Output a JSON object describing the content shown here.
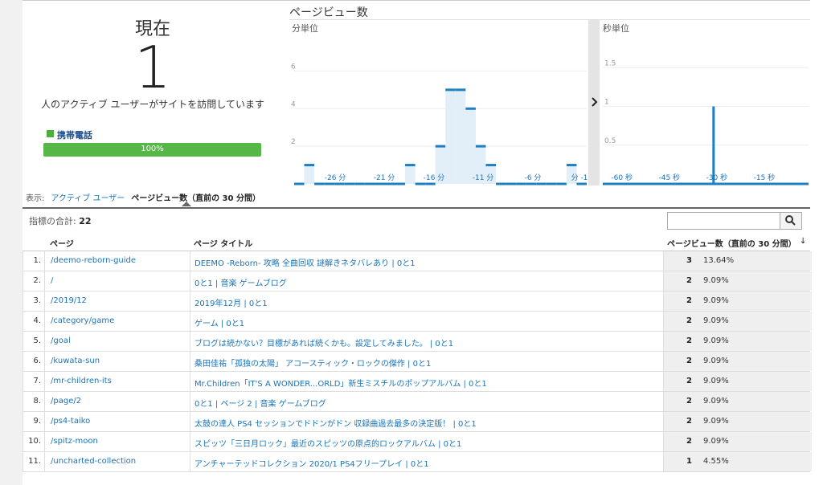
{
  "summary": {
    "now_title": "現在",
    "active_users": "1",
    "description": "人のアクティブ ユーザーがサイトを訪問しています",
    "device_label": "携帯電話",
    "device_percent_text": "100%",
    "device_fraction": 1.0,
    "device_color": "#55b745"
  },
  "chart": {
    "title": "ページビュー数",
    "minute_label": "分単位",
    "second_label": "秒単位",
    "expand_icon": "chevron-right-icon"
  },
  "chart_data": [
    {
      "type": "bar",
      "title": "分単位",
      "ylim": [
        0,
        7
      ],
      "yticks": [
        2,
        4,
        6
      ],
      "xticks": [
        "-26 分",
        "-21 分",
        "-16 分",
        "-11 分",
        "-6 分",
        "分 -1"
      ],
      "categories": [
        "-29",
        "-28",
        "-27",
        "-26",
        "-25",
        "-24",
        "-23",
        "-22",
        "-21",
        "-20",
        "-19",
        "-18",
        "-17",
        "-16",
        "-15",
        "-14",
        "-13",
        "-12",
        "-11",
        "-10",
        "-9",
        "-8",
        "-7",
        "-6",
        "-5",
        "-4",
        "-3",
        "-2",
        "-1"
      ],
      "values": [
        0,
        1,
        0,
        0,
        0,
        0,
        0,
        0,
        0,
        0,
        0,
        1,
        0,
        0,
        2,
        5,
        5,
        4,
        2,
        1,
        0,
        0,
        0,
        0,
        0,
        0,
        0,
        1,
        0
      ]
    },
    {
      "type": "bar",
      "title": "秒単位",
      "ylim": [
        0,
        1.7
      ],
      "yticks": [
        0.5,
        1,
        1.5
      ],
      "xticks": [
        "-60 秒",
        "-45 秒",
        "-30 秒",
        "-15 秒"
      ],
      "spike_at_seconds": -30,
      "spike_value": 1
    }
  ],
  "view_tabs": {
    "prefix": "表示:",
    "tab1": "アクティブ ユーザー",
    "tab2": "ページビュー数（直前の 30 分間）"
  },
  "table": {
    "totals_label": "指標の合計:",
    "totals_value": "22",
    "search_placeholder": "",
    "col_page": "ページ",
    "col_title": "ページ タイトル",
    "col_metric": "ページビュー数（直前の 30 分間）",
    "rows": [
      {
        "n": "1.",
        "path": "/deemo-reborn-guide",
        "title": "DEEMO -Reborn- 攻略 全曲回収 謎解きネタバレあり | 0と1",
        "value": "3",
        "pct": "13.64%"
      },
      {
        "n": "2.",
        "path": "/",
        "title": "0と1 | 音楽 ゲームブログ",
        "value": "2",
        "pct": "9.09%"
      },
      {
        "n": "3.",
        "path": "/2019/12",
        "title": "2019年12月 | 0と1",
        "value": "2",
        "pct": "9.09%"
      },
      {
        "n": "4.",
        "path": "/category/game",
        "title": "ゲーム | 0と1",
        "value": "2",
        "pct": "9.09%"
      },
      {
        "n": "5.",
        "path": "/goal",
        "title": "ブログは続かない？目標があれば続くかも。設定してみました。 | 0と1",
        "value": "2",
        "pct": "9.09%"
      },
      {
        "n": "6.",
        "path": "/kuwata-sun",
        "title": "桑田佳祐「孤独の太陽」 アコースティック・ロックの傑作 | 0と1",
        "value": "2",
        "pct": "9.09%"
      },
      {
        "n": "7.",
        "path": "/mr-children-its",
        "title": "Mr.Children「IT'S A WONDER...ORLD」新生ミスチルのポップアルバム | 0と1",
        "value": "2",
        "pct": "9.09%"
      },
      {
        "n": "8.",
        "path": "/page/2",
        "title": "0と1 | ページ 2 | 音楽 ゲームブログ",
        "value": "2",
        "pct": "9.09%"
      },
      {
        "n": "9.",
        "path": "/ps4-taiko",
        "title": "太鼓の達人 PS4 セッションでドドンがドン 収録曲過去最多の決定版！ | 0と1",
        "value": "2",
        "pct": "9.09%"
      },
      {
        "n": "10.",
        "path": "/spitz-moon",
        "title": "スピッツ「三日月ロック」最近のスピッツの原点的ロックアルバム | 0と1",
        "value": "2",
        "pct": "9.09%"
      },
      {
        "n": "11.",
        "path": "/uncharted-collection",
        "title": "アンチャーテッドコレクション 2020/1 PS4フリープレイ | 0と1",
        "value": "1",
        "pct": "4.55%"
      }
    ]
  }
}
